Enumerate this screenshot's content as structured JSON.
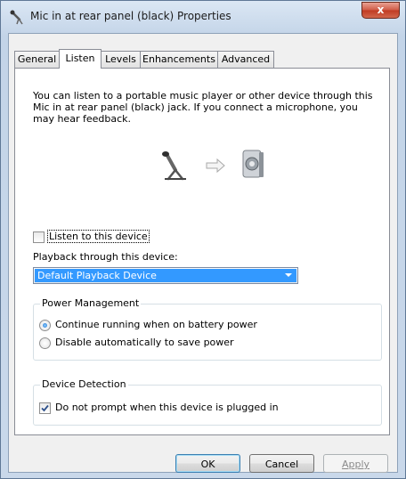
{
  "window": {
    "title": "Mic in at rear panel (black) Properties",
    "close_label": "x"
  },
  "tabs": [
    {
      "label": "General",
      "active": false
    },
    {
      "label": "Listen",
      "active": true
    },
    {
      "label": "Levels",
      "active": false
    },
    {
      "label": "Enhancements",
      "active": false
    },
    {
      "label": "Advanced",
      "active": false
    }
  ],
  "listen": {
    "description": "You can listen to a portable music player or other device through this Mic in at rear panel (black) jack.  If you connect a microphone, you may hear feedback.",
    "illustration": {
      "source_icon": "microphone-icon",
      "arrow_icon": "arrow-right-icon",
      "target_icon": "speaker-icon"
    },
    "listen_checkbox": {
      "label": "Listen to this device",
      "checked": false
    },
    "playback_label": "Playback through this device:",
    "playback_select": {
      "value": "Default Playback Device"
    },
    "power_management": {
      "title": "Power Management",
      "options": [
        {
          "label": "Continue running when on battery power",
          "selected": true
        },
        {
          "label": "Disable automatically to save power",
          "selected": false
        }
      ]
    },
    "device_detection": {
      "title": "Device Detection",
      "checkbox": {
        "label": "Do not prompt when this device is plugged in",
        "checked": true
      }
    }
  },
  "buttons": {
    "ok": "OK",
    "cancel": "Cancel",
    "apply": "Apply"
  },
  "colors": {
    "selection": "#3399ff",
    "close_button": "#c8472f"
  }
}
